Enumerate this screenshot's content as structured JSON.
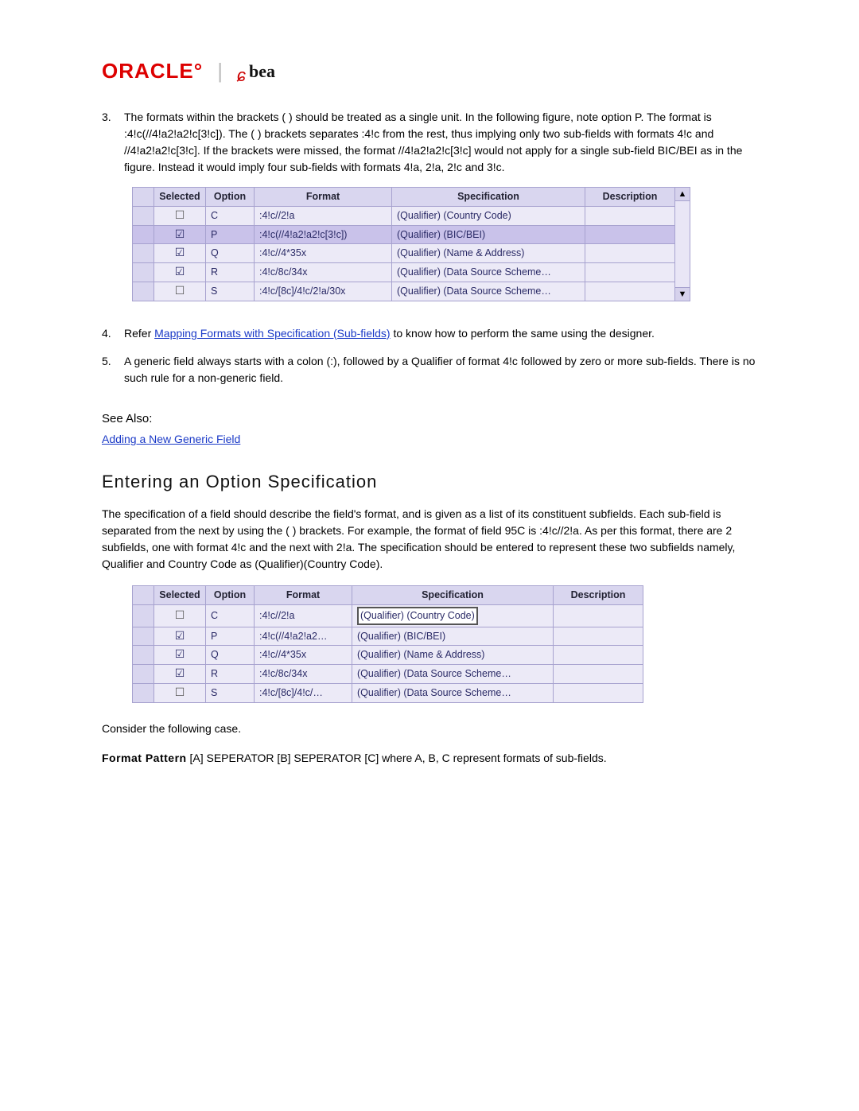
{
  "logo": {
    "oracle": "ORACLE",
    "bea": "bea"
  },
  "para3_num": "3.",
  "para3_text": "The formats within the brackets ( ) should be treated as a single unit. In the following figure, note option P. The format is :4!c(//4!a2!a2!c[3!c]). The ( ) brackets separates :4!c from the rest, thus implying only two sub-fields with formats 4!c and //4!a2!a2!c[3!c]. If the brackets were missed, the format //4!a2!a2!c[3!c] would not apply for a single sub-field BIC/BEI as in the figure. Instead it would imply four sub-fields with formats 4!a, 2!a, 2!c and 3!c.",
  "table1": {
    "headers": {
      "selected": "Selected",
      "option": "Option",
      "format": "Format",
      "specification": "Specification",
      "description": "Description"
    },
    "rows": [
      {
        "selected": false,
        "option": "C",
        "format": ":4!c//2!a",
        "spec": "(Qualifier) (Country Code)",
        "desc": "",
        "sel": false
      },
      {
        "selected": true,
        "option": "P",
        "format": ":4!c(//4!a2!a2!c[3!c])",
        "spec": "(Qualifier) (BIC/BEI)",
        "desc": "",
        "sel": true
      },
      {
        "selected": true,
        "option": "Q",
        "format": ":4!c//4*35x",
        "spec": "(Qualifier) (Name & Address)",
        "desc": "",
        "sel": false
      },
      {
        "selected": true,
        "option": "R",
        "format": ":4!c/8c/34x",
        "spec": "(Qualifier) (Data Source Scheme…",
        "desc": "",
        "sel": false
      },
      {
        "selected": false,
        "option": "S",
        "format": ":4!c/[8c]/4!c/2!a/30x",
        "spec": "(Qualifier) (Data Source Scheme…",
        "desc": "",
        "sel": false
      }
    ]
  },
  "para4_num": "4.",
  "para4_prefix": "Refer ",
  "para4_link": "Mapping Formats with Specification (Sub-fields)",
  "para4_suffix": " to know how to perform the same using the designer.",
  "para5_num": "5.",
  "para5_text": "A generic field always starts with a colon (:), followed by a Qualifier of format 4!c followed by zero or more sub-fields. There is no such rule for a non-generic field.",
  "see_also_label": "See Also:",
  "see_also_link": "Adding a New Generic Field",
  "section_heading": "Entering an Option Specification",
  "section_para": "The specification of a field should describe the field's format, and is given as a list of its constituent subfields. Each sub-field is separated from the next by using the ( ) brackets. For example, the format of field 95C is :4!c//2!a. As per this format, there are 2 subfields, one with format 4!c and the next with 2!a. The specification should be entered to represent these two subfields namely, Qualifier and Country Code as (Qualifier)(Country Code).",
  "table2": {
    "headers": {
      "selected": "Selected",
      "option": "Option",
      "format": "Format",
      "specification": "Specification",
      "description": "Description"
    },
    "rows": [
      {
        "selected": false,
        "option": "C",
        "format": ":4!c//2!a",
        "spec": "(Qualifier) (Country Code)",
        "desc": "",
        "editing": true
      },
      {
        "selected": true,
        "option": "P",
        "format": ":4!c(//4!a2!a2…",
        "spec": "(Qualifier) (BIC/BEI)",
        "desc": "",
        "editing": false
      },
      {
        "selected": true,
        "option": "Q",
        "format": ":4!c//4*35x",
        "spec": "(Qualifier) (Name & Address)",
        "desc": "",
        "editing": false
      },
      {
        "selected": true,
        "option": "R",
        "format": ":4!c/8c/34x",
        "spec": "(Qualifier) (Data Source Scheme…",
        "desc": "",
        "editing": false
      },
      {
        "selected": false,
        "option": "S",
        "format": ":4!c/[8c]/4!c/…",
        "spec": "(Qualifier) (Data Source Scheme…",
        "desc": "",
        "editing": false
      }
    ]
  },
  "consider_text": "Consider the following case.",
  "pattern_label": "Format Pattern",
  "pattern_value": "     [A] SEPERATOR [B] SEPERATOR [C]    where A, B, C represent formats of sub-fields."
}
